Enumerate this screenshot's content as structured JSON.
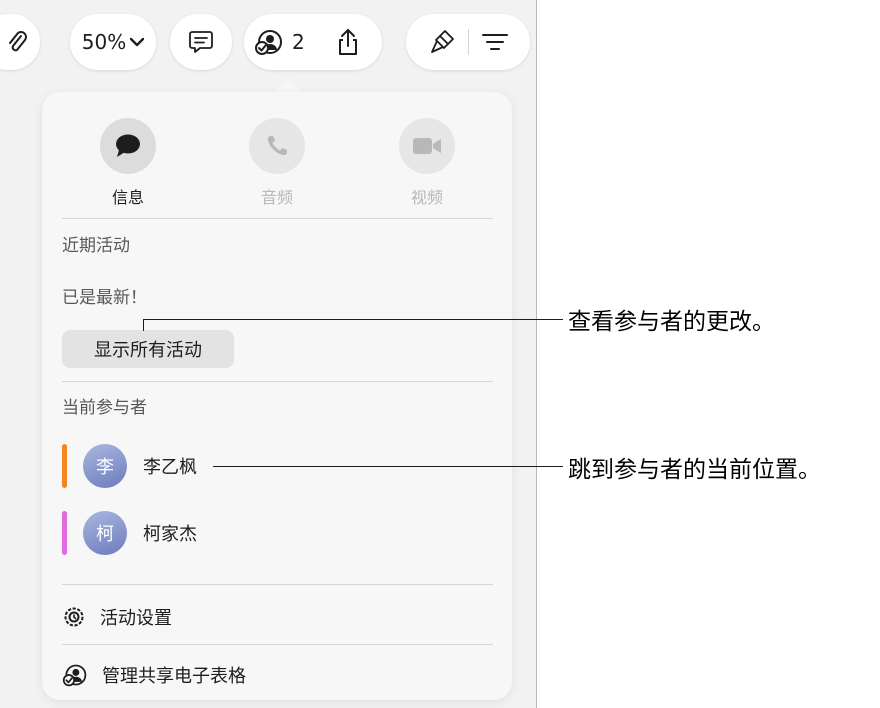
{
  "toolbar": {
    "zoom_value": "50%",
    "collaborator_count": "2"
  },
  "popover": {
    "comm_options": [
      {
        "label": "信息",
        "icon": "message-bubble-icon",
        "enabled": true
      },
      {
        "label": "音频",
        "icon": "phone-icon",
        "enabled": false
      },
      {
        "label": "视频",
        "icon": "video-camera-icon",
        "enabled": false
      }
    ],
    "recent_activity": {
      "title": "近期活动",
      "status": "已是最新！",
      "show_all_label": "显示所有活动"
    },
    "participants": {
      "title": "当前参与者",
      "items": [
        {
          "avatar_initial": "李",
          "name": "李乙枫",
          "color": "#f5861f"
        },
        {
          "avatar_initial": "柯",
          "name": "柯家杰",
          "color": "#e26adf"
        }
      ]
    },
    "menu": {
      "activity_settings": "活动设置",
      "manage_sharing": "管理共享电子表格"
    }
  },
  "callouts": {
    "view_changes": "查看参与者的更改。",
    "jump_to_location": "跳到参与者的当前位置。"
  }
}
